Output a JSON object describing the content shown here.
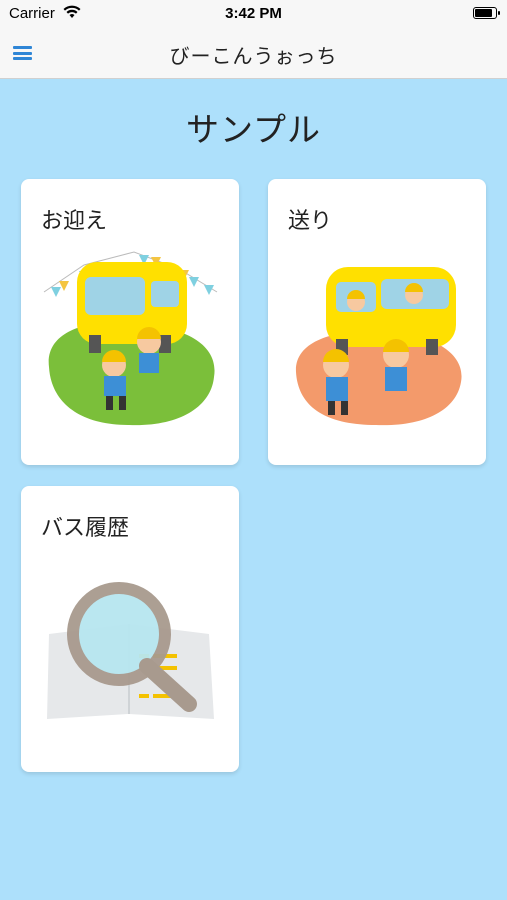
{
  "status_bar": {
    "carrier": "Carrier",
    "time": "3:42 PM",
    "battery_level": 0.9
  },
  "nav": {
    "title": "びーこんうぉっち",
    "menu_icon": "hamburger-menu-icon"
  },
  "page": {
    "heading": "サンプル"
  },
  "cards": [
    {
      "title": "お迎え",
      "illustration": "bus-pickup-illustration"
    },
    {
      "title": "送り",
      "illustration": "bus-dropoff-illustration"
    },
    {
      "title": "バス履歴",
      "illustration": "magnifier-history-illustration"
    }
  ],
  "colors": {
    "background": "#ade0fb",
    "accent": "#2f86d6",
    "bus_yellow": "#ffe000",
    "pickup_ground": "#7bbf3a",
    "dropoff_ground": "#f39a6b"
  }
}
